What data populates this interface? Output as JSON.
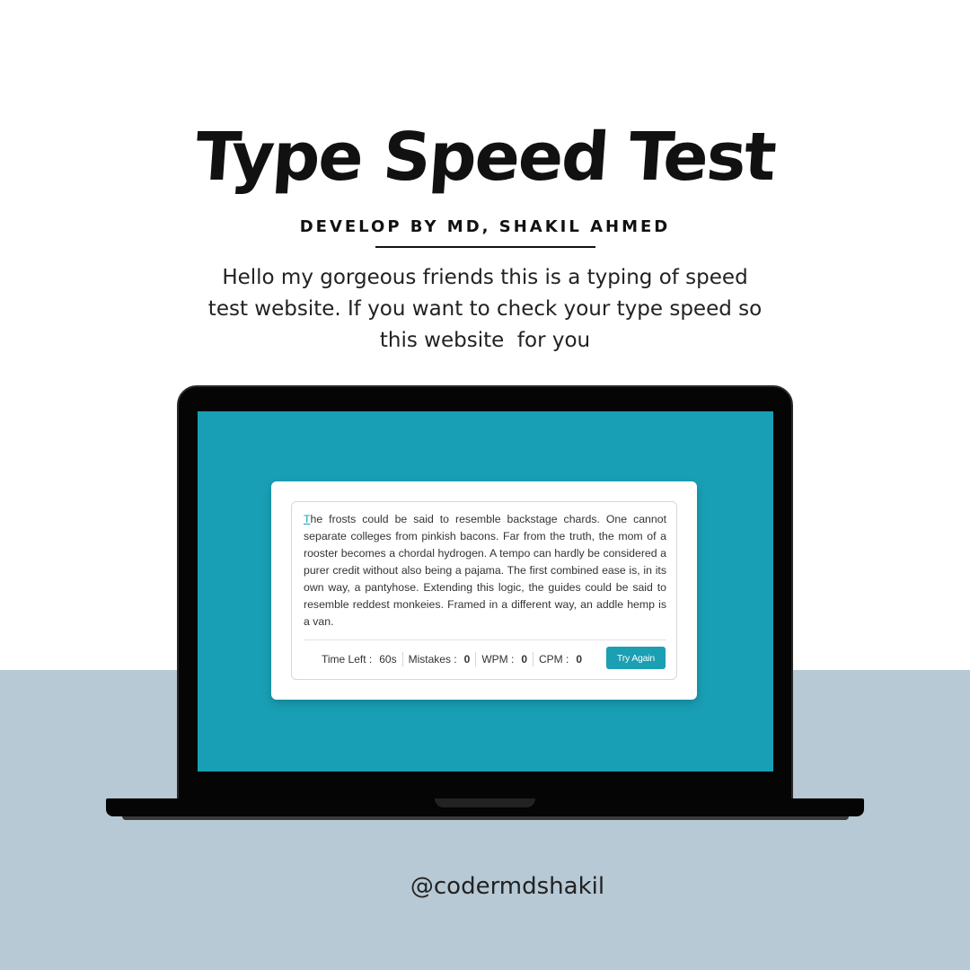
{
  "header": {
    "title": "Type Speed Test",
    "subtitle": "DEVELOP BY MD, SHAKIL AHMED",
    "intro_line1": "Hello my gorgeous friends this is a typing of speed",
    "intro_line2": "test website. If you want to check your type speed so",
    "intro_line3": "this website  for you"
  },
  "app": {
    "paragraph_first_letter": "T",
    "paragraph_rest": "he frosts could be said to resemble backstage chards. One cannot separate colleges from pinkish bacons. Far from the truth, the mom of a rooster becomes a chordal hydrogen. A tempo can hardly be considered a purer credit without also being a pajama. The first combined ease is, in its own way, a pantyhose. Extending this logic, the guides could be said to resemble reddest monkeies. Framed in a different way, an addle hemp is a van.",
    "stats": {
      "time_label": "Time Left :",
      "time_value": "60s",
      "mistakes_label": "Mistakes :",
      "mistakes_value": "0",
      "wpm_label": "WPM :",
      "wpm_value": "0",
      "cpm_label": "CPM :",
      "cpm_value": "0"
    },
    "try_again_label": "Try Again"
  },
  "footer": {
    "handle": "@codermdshakil"
  },
  "colors": {
    "screen_bg": "#199fb5",
    "accent": "#1a9fb3",
    "bottom_band": "#b7c9d5"
  }
}
